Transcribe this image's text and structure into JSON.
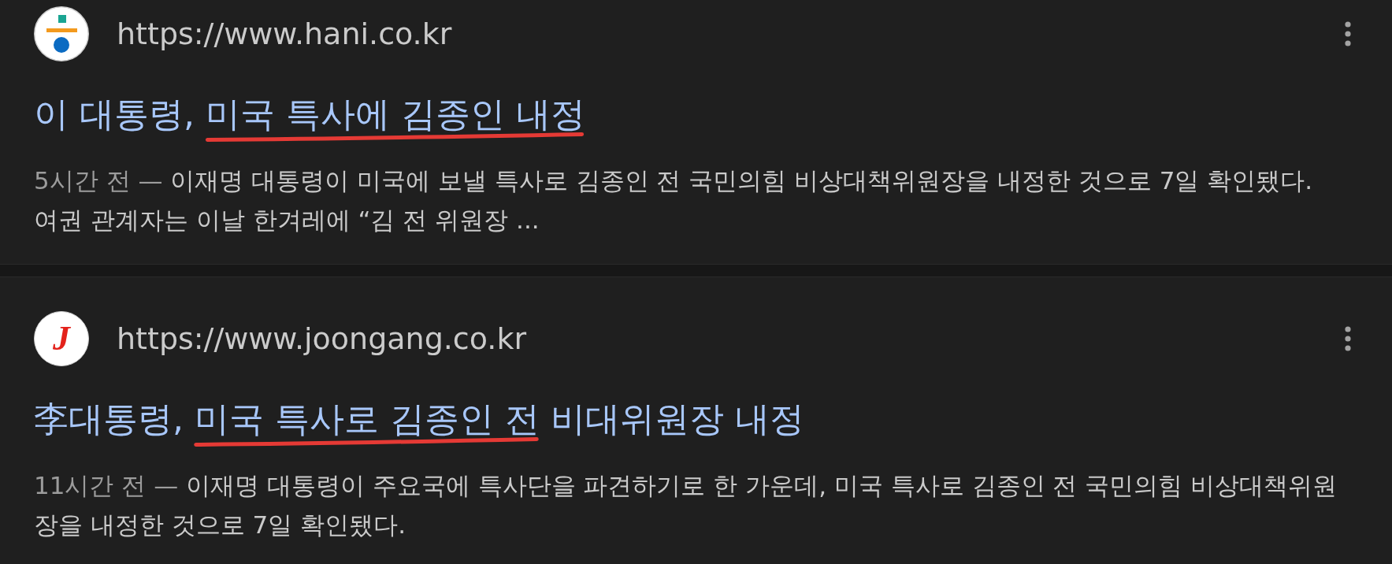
{
  "results": [
    {
      "logo": {
        "kind": "split-mark"
      },
      "url": "https://www.hani.co.kr",
      "title_parts": [
        {
          "text": "이 대통령, ",
          "underlined": false
        },
        {
          "text": "미국 특사에 김종인 내정",
          "underlined": true
        }
      ],
      "age": "5시간 전 —",
      "snippet": "이재명 대통령이 미국에 보낼 특사로 김종인 전 국민의힘 비상대책위원장을 내정한 것으로 7일 확인됐다. 여권 관계자는 이날 한겨레에 “김 전 위원장 ..."
    },
    {
      "logo": {
        "kind": "letter",
        "letter": "J"
      },
      "url": "https://www.joongang.co.kr",
      "title_parts": [
        {
          "text": "李대통령, ",
          "underlined": false
        },
        {
          "text": "미국 특사로 김종인 전",
          "underlined": true
        },
        {
          "text": " 비대위원장 내정",
          "underlined": false
        }
      ],
      "age": "11시간 전 —",
      "snippet": "이재명 대통령이 주요국에 특사단을 파견하기로 한 가운데, 미국 특사로 김종인 전 국민의힘 비상대책위원장을 내정한 것으로 7일 확인됐다."
    }
  ]
}
